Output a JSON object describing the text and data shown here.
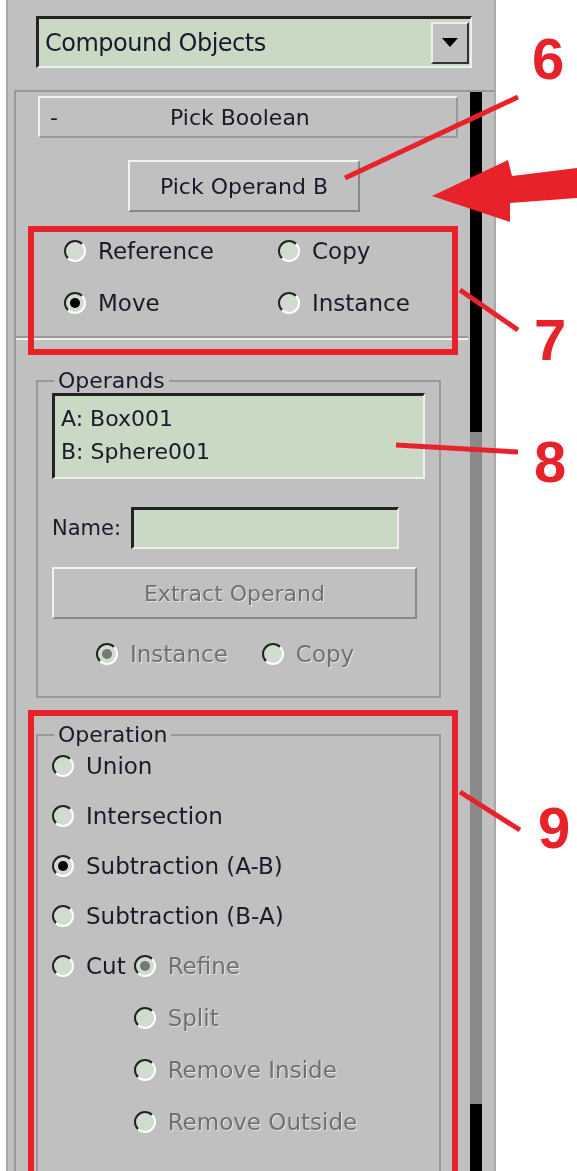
{
  "dropdown": {
    "value": "Compound Objects"
  },
  "rollout": {
    "toggle": "-",
    "title": "Pick Boolean"
  },
  "pick_button": {
    "label": "Pick Operand B"
  },
  "pick_mode": [
    {
      "label": "Reference",
      "selected": false
    },
    {
      "label": "Copy",
      "selected": false
    },
    {
      "label": "Move",
      "selected": true
    },
    {
      "label": "Instance",
      "selected": false
    }
  ],
  "operands": {
    "title": "Operands",
    "list": [
      "A: Box001",
      "B: Sphere001"
    ],
    "name_label": "Name:",
    "extract_button": {
      "label": "Extract Operand",
      "disabled": true
    },
    "extract_mode": [
      {
        "label": "Instance",
        "selected": true,
        "disabled": true
      },
      {
        "label": "Copy",
        "selected": false,
        "disabled": true
      }
    ]
  },
  "operation": {
    "title": "Operation",
    "options": [
      {
        "label": "Union",
        "selected": false
      },
      {
        "label": "Intersection",
        "selected": false
      },
      {
        "label": "Subtraction (A-B)",
        "selected": true
      },
      {
        "label": "Subtraction (B-A)",
        "selected": false
      },
      {
        "label": "Cut",
        "selected": false
      }
    ],
    "cut_options": [
      {
        "label": "Refine",
        "selected": true,
        "disabled": true
      },
      {
        "label": "Split",
        "selected": false,
        "disabled": true
      },
      {
        "label": "Remove Inside",
        "selected": false,
        "disabled": true
      },
      {
        "label": "Remove Outside",
        "selected": false,
        "disabled": true
      }
    ]
  },
  "callouts": [
    {
      "number": "6"
    },
    {
      "number": "7"
    },
    {
      "number": "8"
    },
    {
      "number": "9"
    }
  ]
}
